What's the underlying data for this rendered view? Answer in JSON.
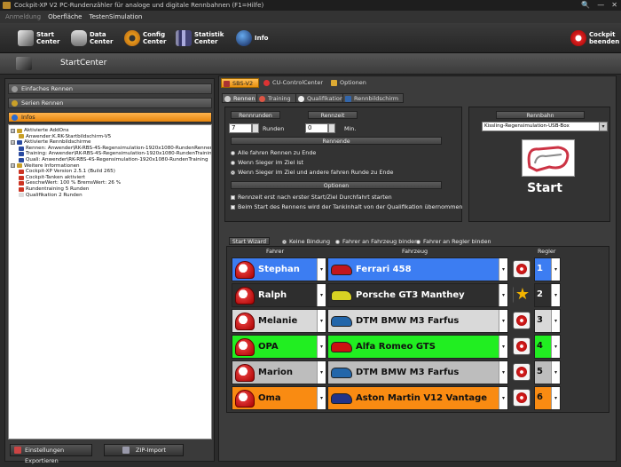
{
  "window": {
    "title": "Cockpit-XP V2 PC-Rundenzähler für analoge und digitale Rennbahnen (F1=Hilfe)",
    "controls": [
      "🔍",
      "—",
      "✕"
    ]
  },
  "menu": [
    {
      "label": "Anmeldung",
      "dim": true
    },
    {
      "label": "Oberfläche",
      "dim": false
    },
    {
      "label": "TestenSimulation",
      "dim": false
    }
  ],
  "toolbar": {
    "start": "Start\nCenter",
    "data": "Data\nCenter",
    "config": "Config\nCenter",
    "statistik": "Statistik\nCenter",
    "info": "Info",
    "exit": "Cockpit\nbeenden"
  },
  "section_title": "StartCenter",
  "left": {
    "accordion": [
      "Einfaches Rennen",
      "Serien Rennen",
      "Infos"
    ],
    "tree": [
      {
        "indent": 0,
        "exp": "⊟",
        "icon": "#c9a028",
        "text": "Aktivierte AddOns"
      },
      {
        "indent": 1,
        "exp": "",
        "icon": "#c9a028",
        "text": "Anwender:K.RK-Startbildschirm-V5"
      },
      {
        "indent": 0,
        "exp": "⊟",
        "icon": "#2a4aa0",
        "text": "Aktivierte Rennbildschirme"
      },
      {
        "indent": 1,
        "exp": "",
        "icon": "#2a4aa0",
        "text": "Rennen: Anwender\\RK-RBS-4S-Regensimulation-1920x1080-RundenRennen"
      },
      {
        "indent": 1,
        "exp": "",
        "icon": "#2a4aa0",
        "text": "Training: Anwender\\RK-RBS-4S-Regensimulation-1920x1080-RundenTraining"
      },
      {
        "indent": 1,
        "exp": "",
        "icon": "#2a4aa0",
        "text": "Quali: Anwender\\RK-RBS-4S-Regensimulation-1920x1080-RundenTraining"
      },
      {
        "indent": 0,
        "exp": "⊟",
        "icon": "#c9a028",
        "text": "Weitere Informationen"
      },
      {
        "indent": 1,
        "exp": "",
        "icon": "#cc3322",
        "text": "Cockpit-XP Version 2.5.1 (Build 265)"
      },
      {
        "indent": 1,
        "exp": "",
        "icon": "#cc3322",
        "text": "Cockpit-Tanken aktiviert"
      },
      {
        "indent": 1,
        "exp": "",
        "icon": "#cc3322",
        "text": "GeschwWert: 100 % BremsWert: 26 %"
      },
      {
        "indent": 1,
        "exp": "",
        "icon": "#cc3322",
        "text": "Rundentraining 5 Runden"
      },
      {
        "indent": 1,
        "exp": "",
        "icon": "#dddddd",
        "text": "Qualifikation 2 Runden"
      }
    ],
    "export_button": "Einstellungen Exportieren",
    "zip_button": "ZIP-Import"
  },
  "tabs_top": [
    "SBS-V2",
    "CU-ControlCenter",
    "Optionen"
  ],
  "tabs_sub": [
    "Rennen",
    "Training",
    "Qualifikation",
    "Rennbildschirm"
  ],
  "settings": {
    "rennrunden_label": "Rennrunden",
    "rennrunden_value": "7",
    "runden_unit": "Runden",
    "rennzeit_label": "Rennzeit",
    "rennzeit_value": "0",
    "min_unit": "Min.",
    "rennende_label": "Rennende",
    "rennende_options": [
      "Alle fahren Rennen zu Ende",
      "Wenn Sieger im Ziel ist",
      "Wenn Sieger im Ziel und andere fahren Runde zu Ende"
    ],
    "rennende_selected": 2,
    "optionen_label": "Optionen",
    "checks": [
      "Rennzeit erst nach erster Start/Ziel Durchfahrt starten",
      "Beim Start des Rennens wird der Tankinhalt von der Qualifikation übernommen"
    ],
    "rennbahn_label": "Rennbahn",
    "rennbahn_value": "Kissling-Regensimulation-USB-Box",
    "start_label": "Start"
  },
  "wizard": {
    "label": "Start Wizard",
    "options": [
      "Keine Bindung",
      "Fahrer an Fahrzeug binden",
      "Fahrer an Regler binden"
    ],
    "col_fahrer": "Fahrer",
    "col_fahrzeug": "Fahrzeug",
    "col_regler": "Regler",
    "rows": [
      {
        "driver": "Stephan",
        "car": "Ferrari 458",
        "num": "1",
        "color": "#3c7df2",
        "dark": true,
        "carcolor": "#c2161d",
        "star": false
      },
      {
        "driver": "Ralph",
        "car": "Porsche GT3 Manthey",
        "num": "2",
        "color": "#2e2e2e",
        "dark": true,
        "carcolor": "#d8d223",
        "star": true
      },
      {
        "driver": "Melanie",
        "car": "DTM BMW M3 Farfus",
        "num": "3",
        "color": "#d9d9d9",
        "dark": false,
        "carcolor": "#2266aa",
        "star": false
      },
      {
        "driver": "OPA",
        "car": "Alfa Romeo GTS",
        "num": "4",
        "color": "#21ee21",
        "dark": false,
        "carcolor": "#cc1111",
        "star": false
      },
      {
        "driver": "Marion",
        "car": "DTM BMW M3 Farfus",
        "num": "5",
        "color": "#bdbdbd",
        "dark": false,
        "carcolor": "#2266aa",
        "star": false
      },
      {
        "driver": "Oma",
        "car": "Aston Martin V12 Vantage",
        "num": "6",
        "color": "#f98b12",
        "dark": false,
        "carcolor": "#223388",
        "star": false
      }
    ]
  }
}
